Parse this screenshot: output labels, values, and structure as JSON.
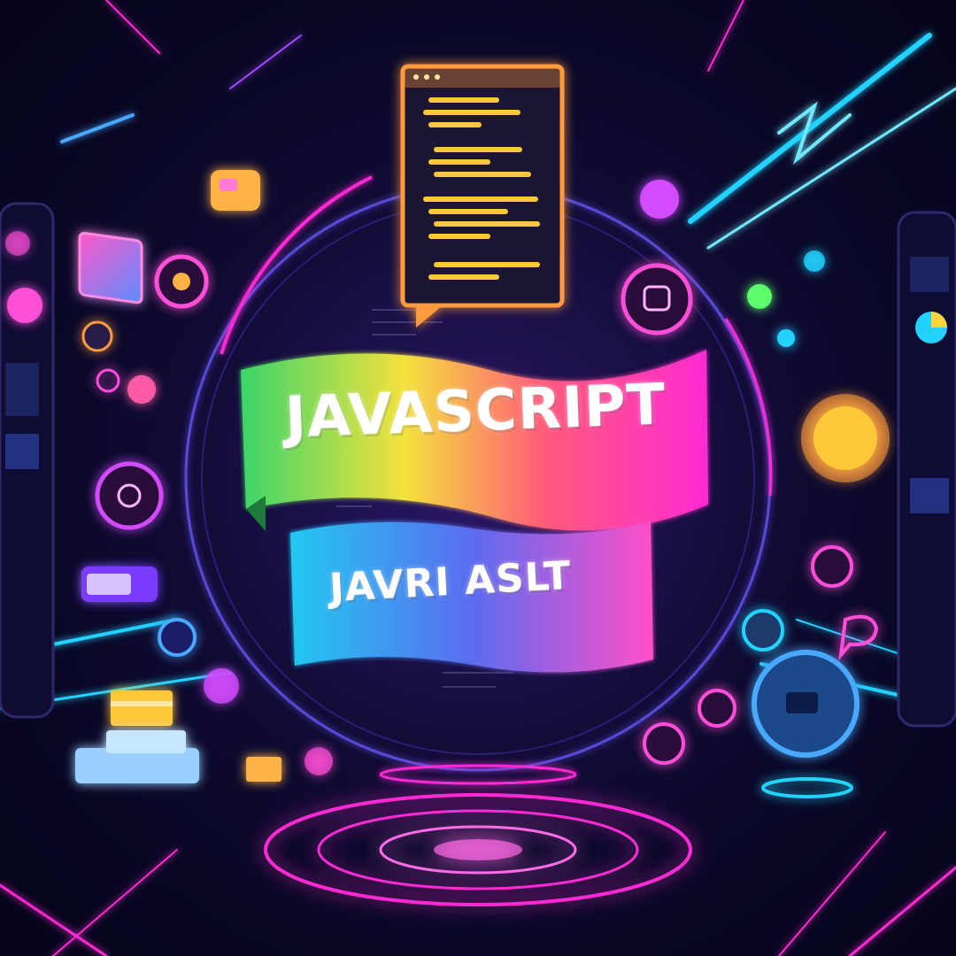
{
  "banner": {
    "top_label": "JAVASCRIPT",
    "bottom_label": "JAVRI ASLT"
  },
  "colors": {
    "background": "#0d0a2e",
    "neon_pink": "#ff2ad4",
    "neon_cyan": "#22d3ff",
    "neon_purple": "#a24bff",
    "neon_orange": "#ff9a3c",
    "code_yellow": "#ffc83a",
    "banner_gradient": [
      "#3bd56a",
      "#f3e23c",
      "#ff5a7a",
      "#ff2ad4"
    ],
    "banner2_gradient": [
      "#22c8f0",
      "#5b6cf0",
      "#ff4fc8"
    ]
  },
  "icons": [
    "code-window-icon",
    "laptop-icon",
    "chat-bubble-icon",
    "orb-icon",
    "gear-icon",
    "cube-icon",
    "folder-icon",
    "printer-icon",
    "cloud-icon",
    "camera-icon",
    "chart-icon"
  ]
}
